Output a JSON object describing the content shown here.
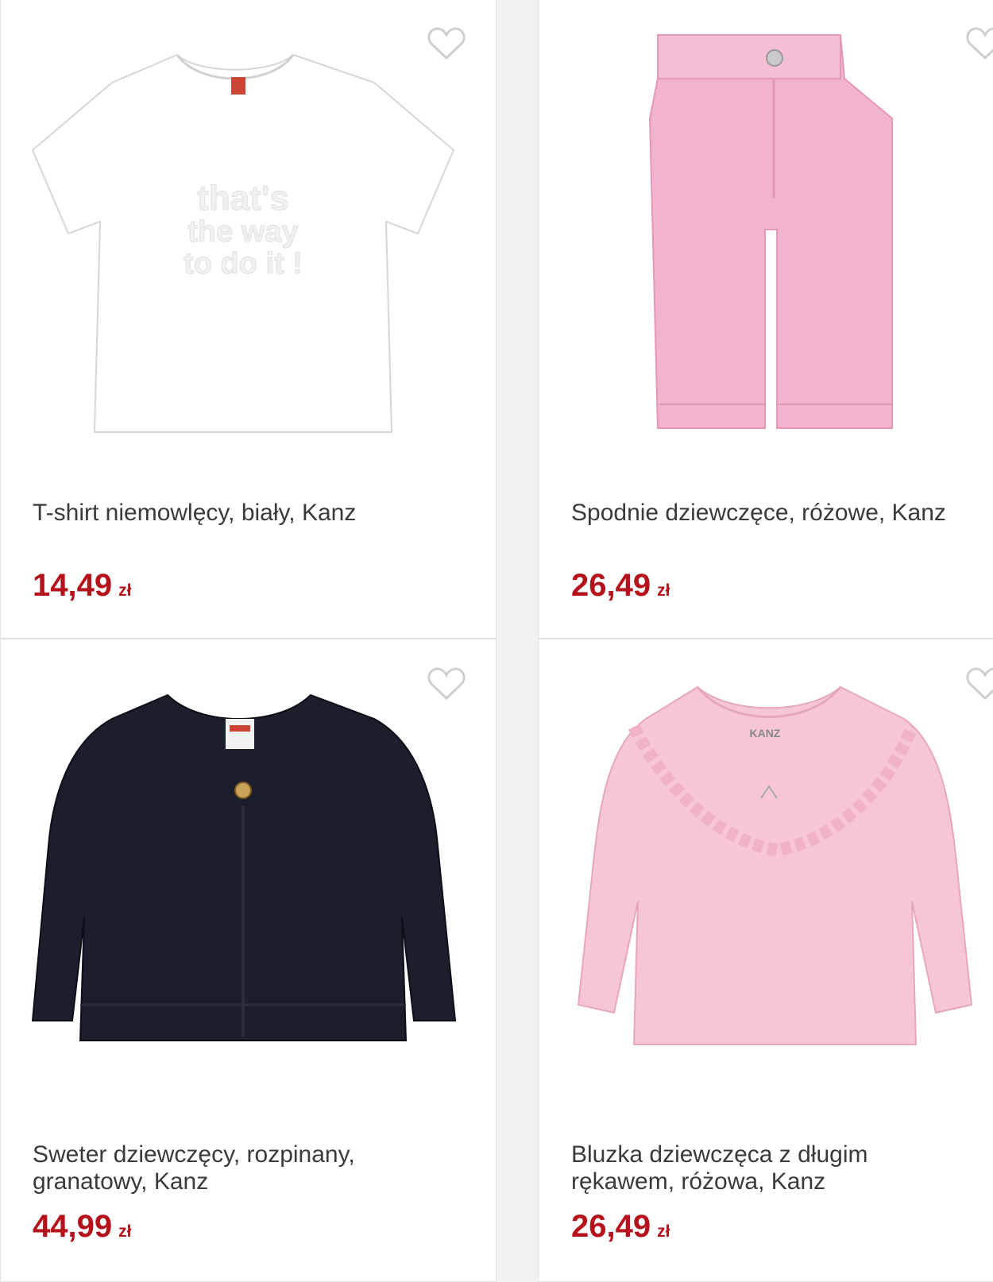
{
  "accent": "#b5121b",
  "products": [
    {
      "title_lines": [
        "T-shirt niemowlęcy, biały, Kanz"
      ],
      "price": "14,49",
      "currency": "zł",
      "heart_icon": "heart-outline-icon"
    },
    {
      "title_lines": [
        "Spodnie dziewczęce, różowe, Kanz"
      ],
      "price": "26,49",
      "currency": "zł",
      "heart_icon": "heart-outline-icon"
    },
    {
      "title_lines": [
        "Sweter dziewczęcy, rozpinany,",
        "granatowy, Kanz"
      ],
      "price": "44,99",
      "currency": "zł",
      "heart_icon": "heart-outline-icon"
    },
    {
      "title_lines": [
        "Bluzka dziewczęca z długim",
        "rękawem, różowa, Kanz"
      ],
      "price": "26,49",
      "currency": "zł",
      "heart_icon": "heart-outline-icon"
    }
  ]
}
